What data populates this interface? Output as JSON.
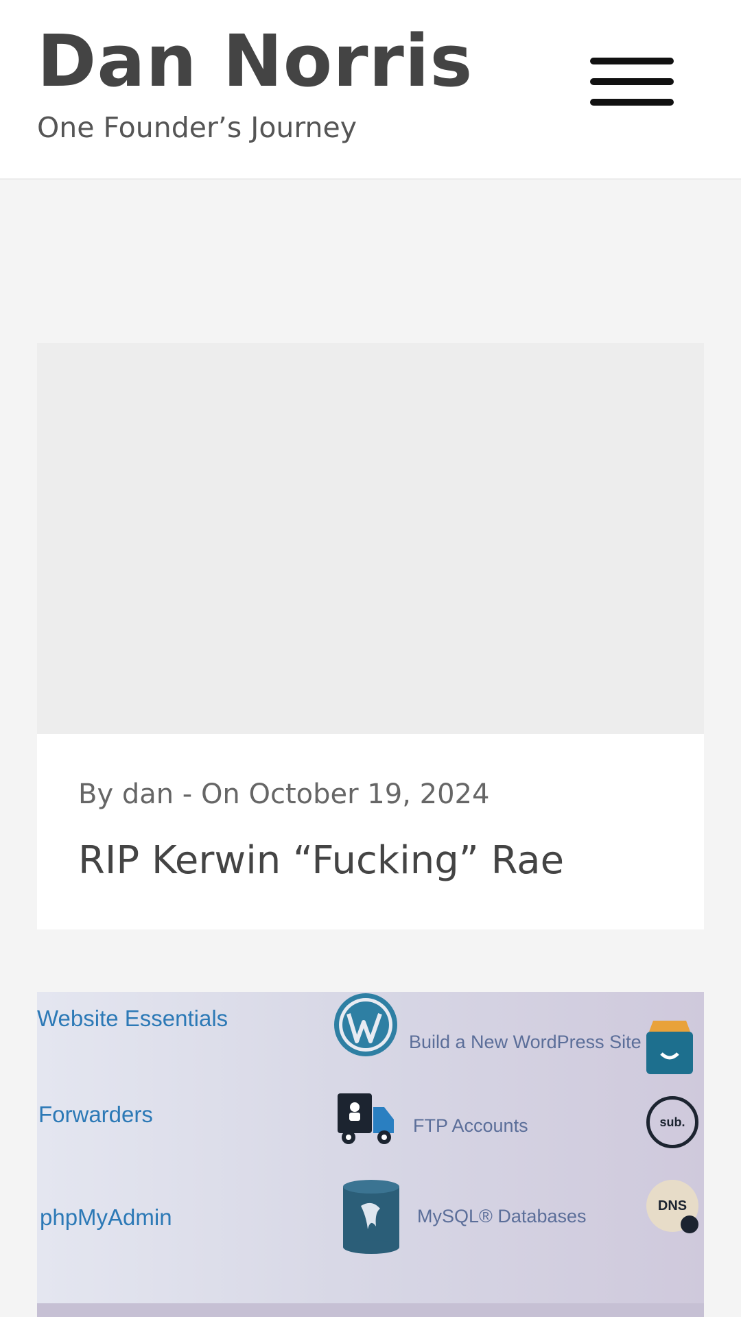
{
  "header": {
    "site_title": "Dan Norris",
    "tagline": "One Founder’s Journey",
    "menu_icon": "hamburger-menu-icon"
  },
  "posts": [
    {
      "meta": "By dan - On October 19, 2024",
      "title": "RIP Kerwin “Fucking” Rae"
    },
    {
      "image_labels": {
        "website_essentials": "Website Essentials",
        "forwarders": "Forwarders",
        "phpmyadmin": "phpMyAdmin",
        "build_wordpress": "Build a New WordPress Site",
        "ftp_accounts": "FTP Accounts",
        "mysql_databases": "MySQL® Databases",
        "sub_badge": "sub.",
        "dns_badge": "DNS"
      }
    }
  ],
  "colors": {
    "page_background": "#f4f4f4",
    "header_background": "#ffffff",
    "text_primary": "#444444",
    "image_placeholder": "#ededed",
    "link_blue": "#2c79b6"
  }
}
